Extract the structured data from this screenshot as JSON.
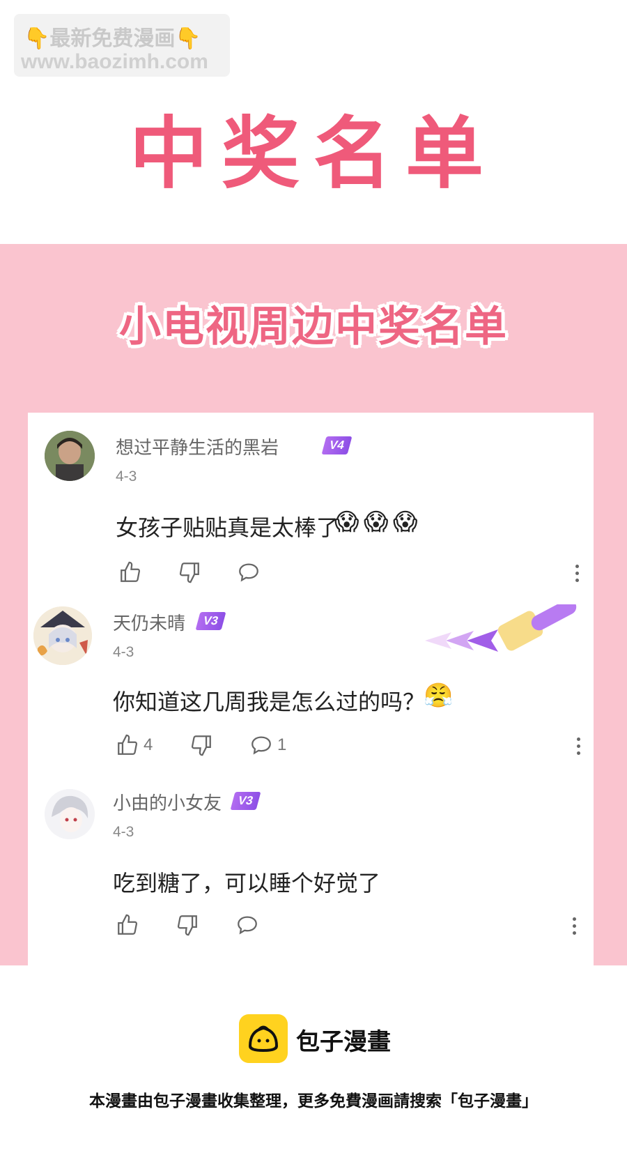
{
  "watermark": {
    "line1_text": "最新免费漫画",
    "line2_text": "www.baozimh.com",
    "hand_icon": "point-down-hand-icon"
  },
  "header": {
    "title": "中奖名单"
  },
  "banner": {
    "subtitle": "小电视周边中奖名单"
  },
  "comments": [
    {
      "username": "想过平静生活的黑岩",
      "level": "V4",
      "date": "4-3",
      "text": "女孩子贴贴真是太棒了",
      "emojis": [
        "😱",
        "😱",
        "😱"
      ],
      "likes": "",
      "replies": ""
    },
    {
      "username": "天仍未晴",
      "level": "V3",
      "date": "4-3",
      "text": "你知道这几周我是怎么过的吗？",
      "emojis": [
        "😤"
      ],
      "likes": "4",
      "replies": "1"
    },
    {
      "username": "小由的小女友",
      "level": "V3",
      "date": "4-3",
      "text": "吃到糖了，可以睡个好觉了",
      "emojis": [],
      "likes": "",
      "replies": ""
    }
  ],
  "footer": {
    "brand": "包子漫畫",
    "note": "本漫畫由包子漫畫收集整理，更多免費漫画請搜索「包子漫畫」"
  },
  "colors": {
    "title_pink": "#ef5a7a",
    "band_pink": "#fac4cf",
    "level_purple": "#9b5cf0",
    "logo_yellow": "#ffd21f"
  }
}
